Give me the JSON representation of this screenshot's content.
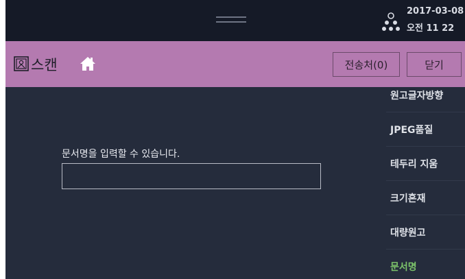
{
  "status_bar": {
    "date": "2017-03-08",
    "time": "오전 11  22",
    "status_icon": "network-status-icon"
  },
  "header": {
    "title": "스캔",
    "scan_icon": "scan-app-icon",
    "home_icon": "home-icon",
    "destination_label": "전송처(0)",
    "close_label": "닫기"
  },
  "main": {
    "doc_name_label": "문서명을 입력할 수 있습니다.",
    "doc_name_value": ""
  },
  "side_menu": {
    "items": [
      {
        "label": "원고글자방향"
      },
      {
        "label": "JPEG품질"
      },
      {
        "label": "테두리 지움"
      },
      {
        "label": "크기혼재"
      },
      {
        "label": "대량원고"
      },
      {
        "label": "문서명"
      }
    ],
    "active_item": "문서명",
    "active_color": "#7cc46a"
  },
  "colors": {
    "header_bg": "#b47ab0",
    "status_bar_bg": "#151a27",
    "main_bg": "#252c3c"
  }
}
